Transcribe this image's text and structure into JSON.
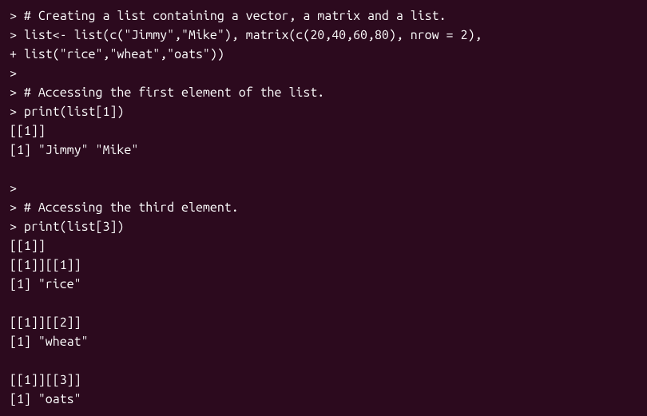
{
  "lines": [
    "> # Creating a list containing a vector, a matrix and a list.",
    "> list<- list(c(\"Jimmy\",\"Mike\"), matrix(c(20,40,60,80), nrow = 2),",
    "+ list(\"rice\",\"wheat\",\"oats\"))",
    ">",
    "> # Accessing the first element of the list.",
    "> print(list[1])",
    "[[1]]",
    "[1] \"Jimmy\" \"Mike\"",
    "",
    ">",
    "> # Accessing the third element.",
    "> print(list[3])",
    "[[1]]",
    "[[1]][[1]]",
    "[1] \"rice\"",
    "",
    "[[1]][[2]]",
    "[1] \"wheat\"",
    "",
    "[[1]][[3]]",
    "[1] \"oats\""
  ]
}
